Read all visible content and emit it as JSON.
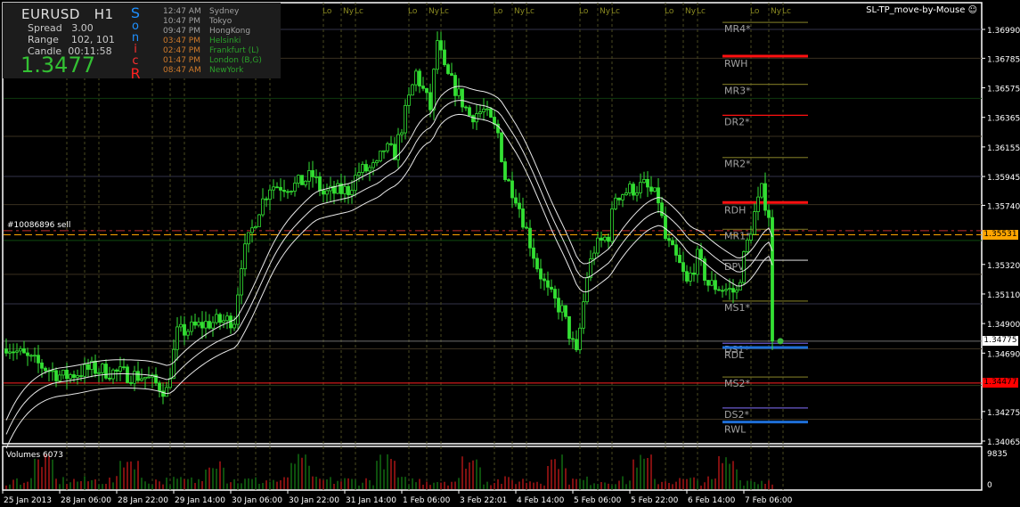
{
  "info_panel": {
    "symbol": "EURUSD",
    "timeframe": "H1",
    "spread_label": "Spread",
    "spread": "3.00",
    "range_label": "Range",
    "range": "102, 101",
    "candle_label": "Candle",
    "candle": "00:11:58",
    "price": "1.3477",
    "sonic_letters": [
      "S",
      "o",
      "n",
      "i",
      "c",
      "R"
    ],
    "sonic_colors": [
      "#1e90ff",
      "#1e90ff",
      "#1e90ff",
      "#ff3030",
      "#ff3030",
      "#ff2020"
    ],
    "clocks": [
      {
        "time": "12:47 AM",
        "city": "Sydney",
        "time_color": "#a0a0a0",
        "city_color": "#a0a0a0"
      },
      {
        "time": "10:47 PM",
        "city": "Tokyo",
        "time_color": "#a0a0a0",
        "city_color": "#a0a0a0"
      },
      {
        "time": "09:47 PM",
        "city": "HongKong",
        "time_color": "#a0a0a0",
        "city_color": "#a0a0a0"
      },
      {
        "time": "03:47 PM",
        "city": "Helsinki",
        "time_color": "#d07a2a",
        "city_color": "#2aa02a"
      },
      {
        "time": "02:47 PM",
        "city": "Frankfurt  (L)",
        "time_color": "#d07a2a",
        "city_color": "#2aa02a"
      },
      {
        "time": "01:47 PM",
        "city": "London  (B,G)",
        "time_color": "#d07a2a",
        "city_color": "#2aa02a"
      },
      {
        "time": "08:47 AM",
        "city": "NewYork",
        "time_color": "#d07a2a",
        "city_color": "#2aa02a"
      }
    ]
  },
  "ea_label": "SL-TP_move-by-Mouse",
  "order_label": "#10086896 sell",
  "volume_label": "Volumes 6073",
  "session_labels": [
    "Lo",
    "Ny",
    "Lc"
  ],
  "colors": {
    "bull": "#33e033",
    "bear": "#33e033",
    "ma": "#e8e8e8",
    "vol_up": "#1aa01a",
    "vol_down": "#ff2020",
    "grid": "#3a3020"
  },
  "chart_data": {
    "type": "candlestick",
    "symbol": "EURUSD",
    "timeframe": "H1",
    "ylim": [
      1.3398,
      1.3712
    ],
    "yticks": [
      "1.36990",
      "1.36785",
      "1.36575",
      "1.36365",
      "1.36155",
      "1.35945",
      "1.35740",
      "1.35320",
      "1.35110",
      "1.34900",
      "1.34690",
      "1.34275",
      "1.34065"
    ],
    "xticks": [
      "25 Jan 2013",
      "28 Jan 06:00",
      "28 Jan 22:00",
      "29 Jan 14:00",
      "30 Jan 06:00",
      "30 Jan 22:00",
      "31 Jan 14:00",
      "1 Feb 06:00",
      "3 Feb 22:01",
      "4 Feb 14:00",
      "5 Feb 06:00",
      "5 Feb 22:00",
      "6 Feb 14:00",
      "7 Feb 06:00"
    ],
    "bars": 216,
    "close_path": [
      [
        0,
        1.3475
      ],
      [
        6,
        1.3465
      ],
      [
        16,
        1.3452
      ],
      [
        24,
        1.3458
      ],
      [
        31,
        1.3455
      ],
      [
        39,
        1.3452
      ],
      [
        45,
        1.3442
      ],
      [
        48,
        1.3483
      ],
      [
        56,
        1.349
      ],
      [
        64,
        1.3493
      ],
      [
        66,
        1.3534
      ],
      [
        71,
        1.3572
      ],
      [
        74,
        1.3588
      ],
      [
        81,
        1.3588
      ],
      [
        86,
        1.3595
      ],
      [
        89,
        1.3582
      ],
      [
        96,
        1.3585
      ],
      [
        99,
        1.3598
      ],
      [
        104,
        1.3601
      ],
      [
        106,
        1.3614
      ],
      [
        109,
        1.3611
      ],
      [
        111,
        1.363
      ],
      [
        115,
        1.3668
      ],
      [
        119,
        1.3643
      ],
      [
        121,
        1.3691
      ],
      [
        123,
        1.3669
      ],
      [
        126,
        1.3657
      ],
      [
        130,
        1.3638
      ],
      [
        134,
        1.3641
      ],
      [
        138,
        1.3625
      ],
      [
        140,
        1.3594
      ],
      [
        143,
        1.3581
      ],
      [
        146,
        1.3556
      ],
      [
        149,
        1.3531
      ],
      [
        152,
        1.3512
      ],
      [
        156,
        1.3499
      ],
      [
        160,
        1.3467
      ],
      [
        163,
        1.3524
      ],
      [
        165,
        1.3543
      ],
      [
        169,
        1.3553
      ],
      [
        171,
        1.3581
      ],
      [
        175,
        1.3585
      ],
      [
        179,
        1.3588
      ],
      [
        183,
        1.3578
      ],
      [
        185,
        1.355
      ],
      [
        189,
        1.3531
      ],
      [
        191,
        1.3518
      ],
      [
        194,
        1.3537
      ],
      [
        197,
        1.3518
      ],
      [
        201,
        1.3515
      ],
      [
        205,
        1.3512
      ],
      [
        207,
        1.3537
      ],
      [
        210,
        1.3568
      ],
      [
        212,
        1.3584
      ],
      [
        214,
        1.3568
      ],
      [
        215,
        1.34775
      ]
    ],
    "price_badges": [
      {
        "label": "1.35531",
        "value": 1.35531,
        "bg": "#ffa500",
        "fg": "#000"
      },
      {
        "label": "1.34775",
        "value": 1.34775,
        "bg": "#ffffff",
        "fg": "#000"
      },
      {
        "label": "1.34477",
        "value": 1.34477,
        "bg": "#ff0000",
        "fg": "#000"
      }
    ],
    "pivot_levels": [
      {
        "label": "MR4*",
        "value": 1.3704,
        "color": "#6e6a20",
        "thick": false
      },
      {
        "label": "RWH",
        "value": 1.368,
        "color": "#ff1010",
        "thick": true
      },
      {
        "label": "MR3*",
        "value": 1.366,
        "color": "#6e6a20",
        "thick": false
      },
      {
        "label": "DR2*",
        "value": 1.3638,
        "color": "#ff1010",
        "thick": false
      },
      {
        "label": "MR2*",
        "value": 1.3608,
        "color": "#6e6a20",
        "thick": false
      },
      {
        "label": "RDH",
        "value": 1.3576,
        "color": "#ff1010",
        "thick": true
      },
      {
        "label": "MR1*",
        "value": 1.3557,
        "color": "#6e6a20",
        "thick": false
      },
      {
        "label": "DPV",
        "value": 1.3535,
        "color": "#c8c8c8",
        "thick": false
      },
      {
        "label": "MS1*",
        "value": 1.3506,
        "color": "#6e6a20",
        "thick": false
      },
      {
        "label": "DS1*",
        "value": 1.3476,
        "color": "#6a5acd",
        "thick": false
      },
      {
        "label": "RDL",
        "value": 1.3473,
        "color": "#1e6fd8",
        "thick": true
      },
      {
        "label": "MS2*",
        "value": 1.3452,
        "color": "#6e6a20",
        "thick": false
      },
      {
        "label": "DS2*",
        "value": 1.343,
        "color": "#6a5acd",
        "thick": false
      },
      {
        "label": "RWL",
        "value": 1.342,
        "color": "#1e6fd8",
        "thick": true
      }
    ],
    "volume": {
      "label": "Volumes",
      "current": 6073,
      "ymax_label": "9835",
      "ymin_label": "0"
    }
  }
}
